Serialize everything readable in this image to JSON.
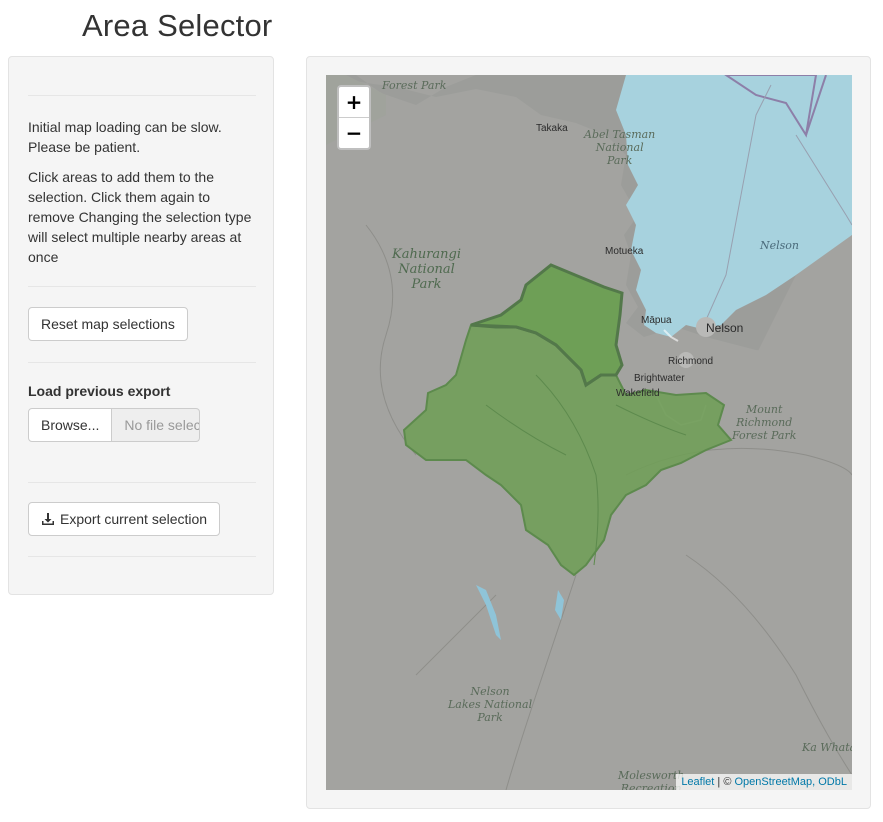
{
  "page": {
    "title": "Area Selector"
  },
  "sidebar": {
    "intro": "Initial map loading can be slow. Please be patient.",
    "instructions": "Click areas to add them to the selection. Click them again to remove Changing the selection type will select multiple nearby areas at once",
    "reset_label": "Reset map selections",
    "load_label": "Load previous export",
    "browse_label": "Browse...",
    "file_placeholder": "No file selected",
    "export_label": "Export current selection"
  },
  "map": {
    "zoom_in": "+",
    "zoom_out": "−",
    "attribution_leaflet": "Leaflet",
    "attribution_sep": " | © ",
    "attribution_osm": "OpenStreetMap, ODbL",
    "places": {
      "forest_park_top": "Forest Park",
      "takaka": "Takaka",
      "abel_tasman": "Abel Tasman\nNational\nPark",
      "kahurangi": "Kahurangi\nNational\nPark",
      "motueka": "Motueka",
      "nelson_sea": "Nelson",
      "mapua": "Māpua",
      "nelson_city": "Nelson",
      "richmond": "Richmond",
      "brightwater": "Brightwater",
      "wakefield": "Wakefield",
      "mount_richmond": "Mount\nRichmond\nForest Park",
      "nelson_lakes": "Nelson\nLakes National\nPark",
      "molesworth": "Molesworth\nRecreation",
      "ka_whata": "Ka Whata"
    },
    "colors": {
      "land": "#a3a3a0",
      "sea": "#a7d2de",
      "selected": "#6e9f55",
      "border": "#53784a"
    }
  }
}
